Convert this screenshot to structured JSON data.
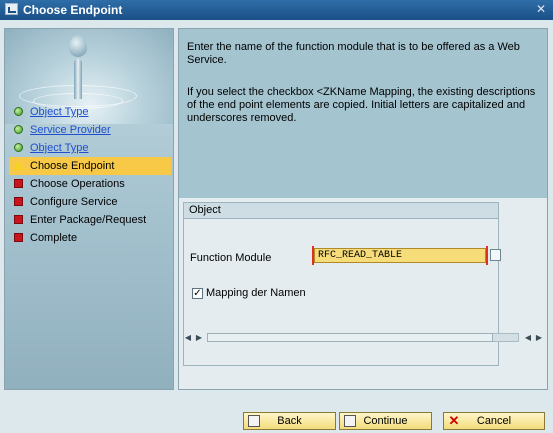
{
  "window": {
    "title": "Choose Endpoint",
    "close_glyph": "✕"
  },
  "steps": [
    {
      "label": "Object Type",
      "status": "done",
      "link": true
    },
    {
      "label": "Service Provider",
      "status": "done",
      "link": true
    },
    {
      "label": "Object Type",
      "status": "done",
      "link": true
    },
    {
      "label": "Choose Endpoint",
      "status": "current",
      "link": false
    },
    {
      "label": "Choose Operations",
      "status": "pending",
      "link": false
    },
    {
      "label": "Configure Service",
      "status": "pending",
      "link": false
    },
    {
      "label": "Enter Package/Request",
      "status": "pending",
      "link": false
    },
    {
      "label": "Complete",
      "status": "pending",
      "link": false
    }
  ],
  "info": {
    "paragraph1": "Enter the name of the function module that is to be offered as a Web Service.",
    "paragraph2": "If you select the checkbox <ZKName Mapping, the existing descriptions of the end point elements are copied. Initial letters are capitalized and underscores removed."
  },
  "group": {
    "title": "Object",
    "function_module_label": "Function Module",
    "function_module_value": "RFC_READ_TABLE",
    "mapping_label": "Mapping der Namen",
    "mapping_checked": true,
    "check_glyph": "✓"
  },
  "scrollbar": {
    "left_glyph": "◀",
    "right_glyph": "▶",
    "grip": "..."
  },
  "buttons": {
    "back": "Back",
    "continue": "Continue",
    "cancel": "Cancel",
    "cancel_glyph": "✕"
  },
  "colors": {
    "titlebar": "#1a4f86",
    "current_step": "#f7c946",
    "info_panel": "#a4c4d0",
    "input_required": "#f7dc7a",
    "button": "#f3dc7c"
  },
  "icons": {
    "done": "green-circle-icon",
    "current": "yellow-triangle-icon",
    "pending": "red-square-icon"
  }
}
